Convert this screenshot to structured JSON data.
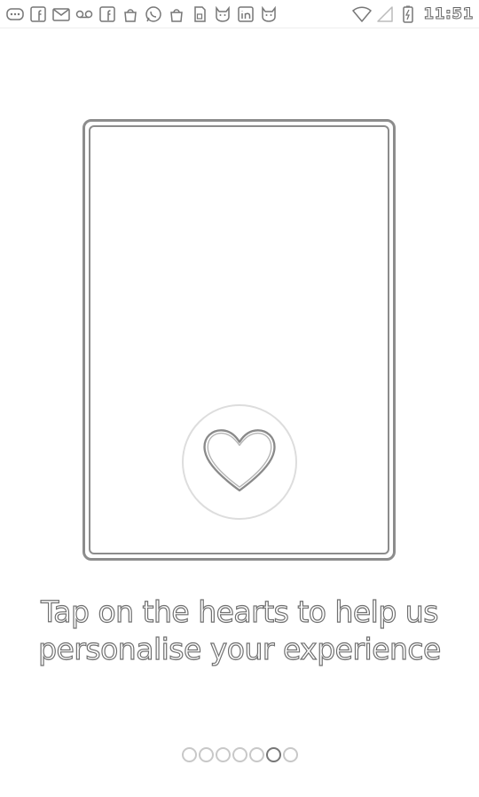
{
  "status_bar": {
    "time": "11:51",
    "icons": [
      "messages-icon",
      "facebook-icon",
      "gmail-icon",
      "voicemail-icon",
      "facebook-icon",
      "bag-icon",
      "whatsapp-icon",
      "bag-icon",
      "sim-icon",
      "cat-icon",
      "linkedin-icon",
      "cat-icon",
      "wifi-icon",
      "no-signal-icon",
      "battery-charging-icon"
    ]
  },
  "onboarding": {
    "caption": "Tap on the hearts to help us personalise your experience",
    "heart_button_icon": "heart-icon",
    "pages_total": 7,
    "page_current": 6
  },
  "colors": {
    "outline": "#8c8c8c",
    "ring": "#dddddd",
    "dot_inactive": "#c8c8c8",
    "dot_active": "#777777"
  }
}
